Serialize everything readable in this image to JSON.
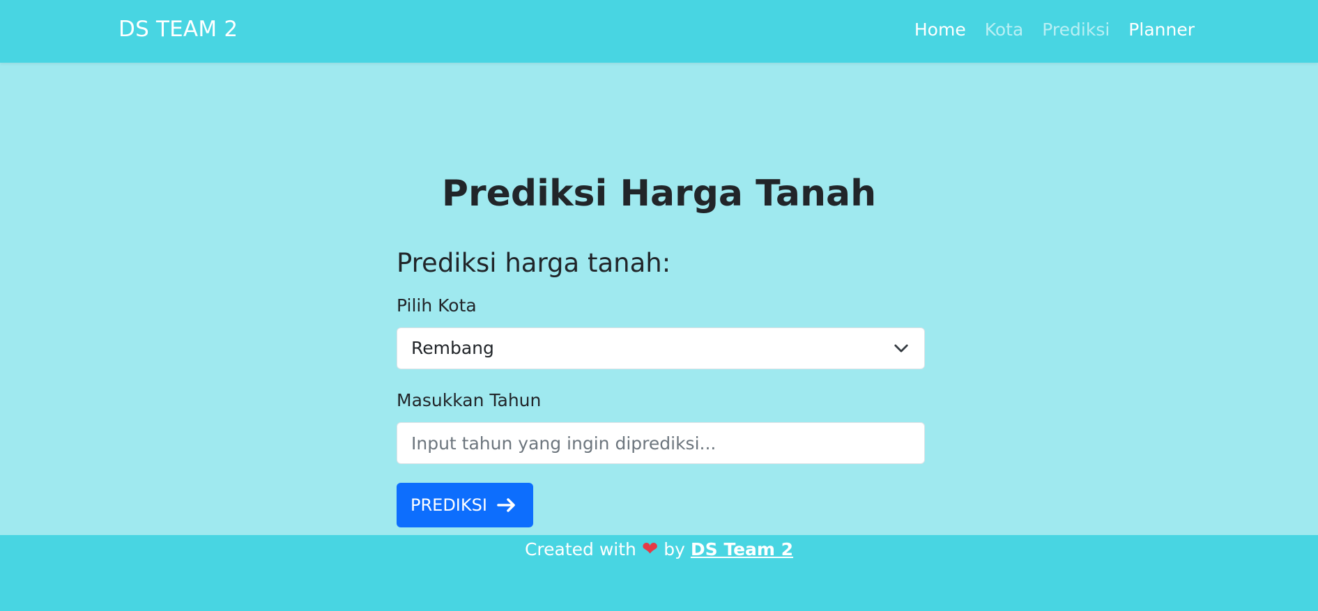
{
  "navbar": {
    "brand": "DS TEAM 2",
    "links": [
      {
        "label": "Home"
      },
      {
        "label": "Kota"
      },
      {
        "label": "Prediksi"
      },
      {
        "label": "Planner"
      }
    ]
  },
  "main": {
    "title": "Prediksi Harga Tanah",
    "form": {
      "heading": "Prediksi harga tanah:",
      "city_label": "Pilih Kota",
      "city_selected": "Rembang",
      "city_icon": "chevron-down-icon",
      "year_label": "Masukkan Tahun",
      "year_placeholder": "Input tahun yang ingin diprediksi...",
      "year_value": "",
      "submit_label": "PREDIKSI",
      "submit_icon": "arrow-right-icon"
    }
  },
  "footer": {
    "prefix": "Created with",
    "heart_icon": "heart-icon",
    "by": "by",
    "team_link": "DS Team 2"
  },
  "colors": {
    "navbar_bg": "#48d5e2",
    "page_bg": "#9fe9ef",
    "button_bg": "#0d6efd",
    "heart": "#e63946"
  }
}
